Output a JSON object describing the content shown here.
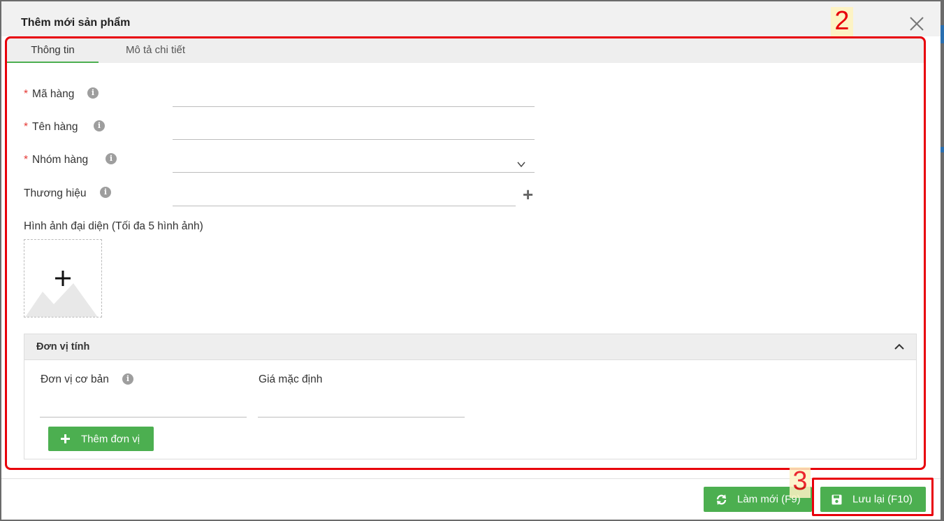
{
  "dialog": {
    "title": "Thêm mới sản phẩm",
    "close_icon": "close-icon"
  },
  "tabs": [
    {
      "label": "Thông tin",
      "active": true
    },
    {
      "label": "Mô tả chi tiết",
      "active": false
    }
  ],
  "form": {
    "required_mark": "*",
    "ma_hang": {
      "label": "Mã hàng",
      "value": ""
    },
    "ten_hang": {
      "label": "Tên hàng",
      "value": ""
    },
    "nhom_hang": {
      "label": "Nhóm hàng",
      "value": ""
    },
    "thuong_hieu": {
      "label": "Thương hiệu",
      "value": ""
    },
    "info_icon": "i",
    "image_label": "Hình ảnh đại diện (Tối đa 5 hình ảnh)"
  },
  "unit_section": {
    "title": "Đơn vị tính",
    "base_unit_label": "Đơn vị cơ bản",
    "default_price_label": "Giá mặc định",
    "add_unit_button": "Thêm đơn vị"
  },
  "footer": {
    "refresh_button": "Làm mới (F9)",
    "save_button": "Lưu lại (F10)"
  },
  "annotations": [
    {
      "number": "2"
    },
    {
      "number": "3"
    }
  ],
  "colors": {
    "accent_green": "#4caf50",
    "annotation_red": "#e8000b",
    "annotation_number_bg": "#fdf3c4"
  }
}
